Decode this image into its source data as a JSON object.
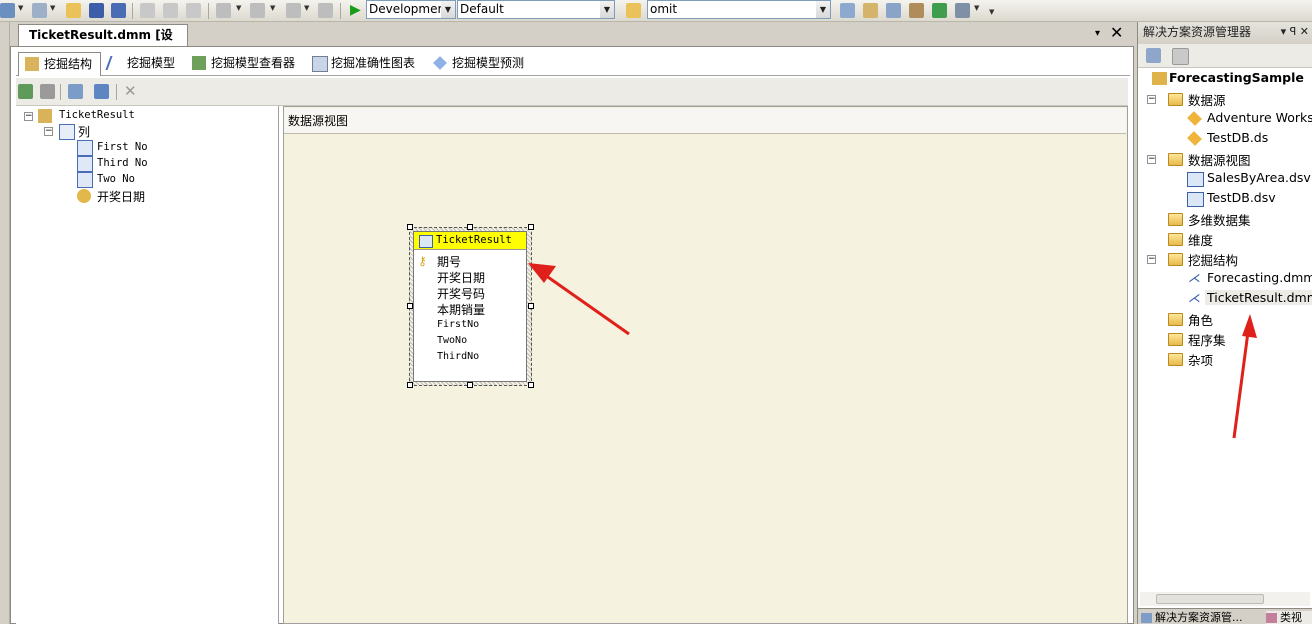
{
  "toolbar": {
    "solution_config": "Developmer",
    "platform": "Default",
    "find_text": "omit"
  },
  "document": {
    "tab_title": "TicketResult.dmm [设计]*",
    "pin_glyph": "▾",
    "close_glyph": "✕"
  },
  "designer_tabs": [
    {
      "label": "挖掘结构"
    },
    {
      "label": "挖掘模型"
    },
    {
      "label": "挖掘模型查看器"
    },
    {
      "label": "挖掘准确性图表"
    },
    {
      "label": "挖掘模型预测"
    }
  ],
  "structure_tree": {
    "root": "TicketResult",
    "columns_folder": "列",
    "columns": [
      "First No",
      "Third No",
      "Two No"
    ],
    "key": "开奖日期"
  },
  "dsv": {
    "header": "数据源视图",
    "table": {
      "name": "TicketResult",
      "columns": [
        "期号",
        "开奖日期",
        "开奖号码",
        "本期销量",
        "FirstNo",
        "TwoNo",
        "ThirdNo"
      ]
    }
  },
  "solution_explorer": {
    "title": "解决方案资源管理器",
    "title_buttons": "▾ ꟼ ✕",
    "project": "ForecastingSample",
    "nodes": {
      "data_sources": "数据源",
      "ds1": "Adventure Works",
      "ds2": "TestDB.ds",
      "dsv_folder": "数据源视图",
      "dsv1": "SalesByArea.dsv",
      "dsv2": "TestDB.dsv",
      "cubes": "多维数据集",
      "dimensions": "维度",
      "mining_structures": "挖掘结构",
      "ms1": "Forecasting.dmm",
      "ms2": "TicketResult.dmm",
      "roles": "角色",
      "assemblies": "程序集",
      "misc": "杂项"
    },
    "bottom_tabs": [
      "解决方案资源管...",
      "类视"
    ]
  },
  "colors": {
    "dsv_background": "#f5f2df",
    "table_header": "#ffff00",
    "annotation_arrow": "#e0201b"
  }
}
